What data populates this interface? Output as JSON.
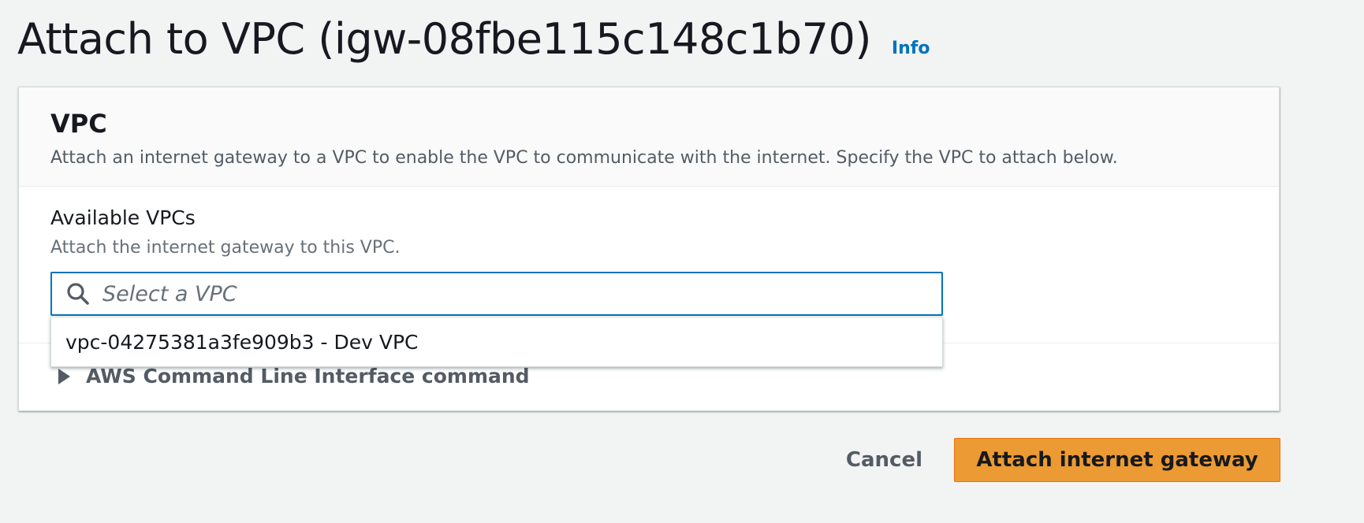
{
  "header": {
    "title": "Attach to VPC (igw-08fbe115c148c1b70)",
    "info_link": "Info"
  },
  "panel": {
    "title": "VPC",
    "description": "Attach an internet gateway to a VPC to enable the VPC to communicate with the internet. Specify the VPC to attach below.",
    "field": {
      "label": "Available VPCs",
      "hint": "Attach the internet gateway to this VPC.",
      "placeholder": "Select a VPC",
      "value": "",
      "search_icon": "search-icon"
    },
    "dropdown": {
      "options": [
        {
          "label": "vpc-04275381a3fe909b3 - Dev VPC"
        }
      ]
    },
    "cli": {
      "label": "AWS Command Line Interface command",
      "icon": "caret-right-icon",
      "expanded": false
    }
  },
  "actions": {
    "cancel_label": "Cancel",
    "primary_label": "Attach internet gateway"
  },
  "colors": {
    "background": "#f2f3f3",
    "link": "#0073bb",
    "primary_button": "#ec9a33",
    "focus_border": "#0073bb"
  }
}
